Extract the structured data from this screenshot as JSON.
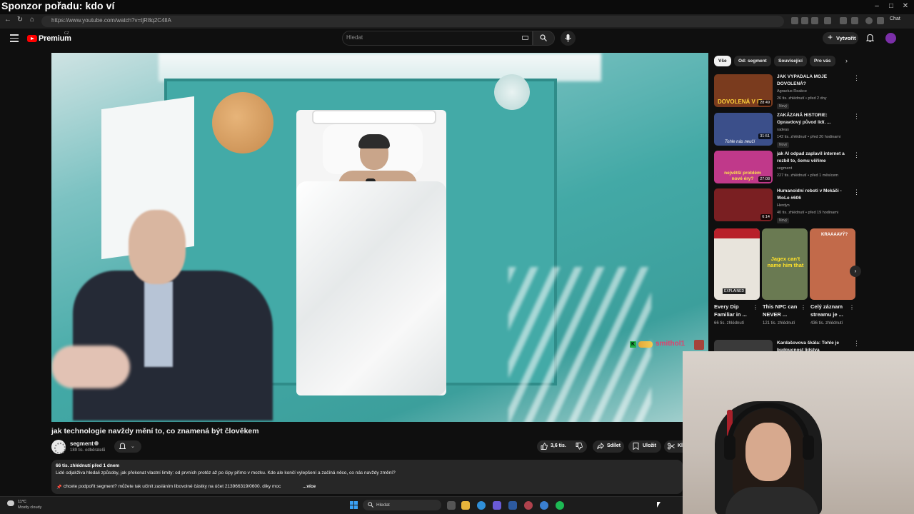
{
  "overlay": {
    "title": "Sponzor pořadu: kdo ví"
  },
  "browser": {
    "url": "https://www.youtube.com/watch?v=tjR8q2C4IlA",
    "copilot_label": "Chat",
    "window_controls": [
      "–",
      "□",
      "✕"
    ]
  },
  "header": {
    "brand": "Premium",
    "country": "CZ",
    "search_placeholder": "Hledat",
    "create_label": "Vytvořit",
    "accent": "#ff0000"
  },
  "player": {
    "chat_username": "smithol1",
    "chat_badge": "K"
  },
  "video": {
    "title": "jak technologie navždy mění to, co znamená být člověkem",
    "channel_name": "segment",
    "subscribers": "189 tis. odběratelů",
    "likes": "3,6 tis.",
    "share_label": "Sdílet",
    "save_label": "Uložit",
    "clip_label": "Kl",
    "description": {
      "meta": "66 tis. zhlédnutí  před 1 dnem",
      "line1": "Lidé odjakživa hledali způsoby, jak překonat vlastní limity: od prvních protéz až po čipy přímo v mozku. Kde ale končí vylepšení a začíná něco, co nás navždy změní?",
      "line2": "chcete podpořit segment? můžete tak učinit zasláním libovolné částky na účet 213966319/0600. díky moc",
      "more": "...více"
    }
  },
  "sidebar": {
    "chips": [
      "Vše",
      "Od: segment",
      "Související",
      "Pro vás"
    ],
    "recommendations": [
      {
        "title": "JAK VYPADALA MOJE DOVOLENÁ?",
        "channel": "Agraelus Reakce",
        "stats": "26 tis. zhlédnutí • před 2 dny",
        "badge": "Nový",
        "duration": "28:49",
        "thumb_text": "DOVOLENÁ V IT",
        "thumb_color": "#7a3b1e"
      },
      {
        "title": "ZAKÁZANÁ HISTORIE: Opravdový původ lidí. ...",
        "channel": "radeas",
        "stats": "142 tis. zhlédnutí • před 20 hodinami",
        "badge": "Nový",
        "duration": "31:51",
        "thumb_text": "Tohle nás neučí",
        "thumb_color": "#3b4f8a"
      },
      {
        "title": "jak AI odpad zaplavil internet a rozbil to, čemu věříme",
        "channel": "segment",
        "stats": "227 tis. zhlédnutí • před 1 měsícem",
        "badge": "",
        "duration": "27:08",
        "thumb_text": "největší problém nové éry?",
        "thumb_color": "#c0398a"
      },
      {
        "title": "Humanoidní roboti v Mekáči - WoLe #606",
        "channel": "Herdyn",
        "stats": "40 tis. zhlédnutí • před 19 hodinami",
        "badge": "Nový",
        "duration": "6:14",
        "thumb_text": "",
        "thumb_color": "#7a1f22"
      },
      {
        "title": "Kardašovova škála: Tohle je budoucnost lidstva",
        "channel": "",
        "stats": "",
        "badge": "",
        "duration": "",
        "thumb_text": "",
        "thumb_color": "#3a3a3a"
      }
    ],
    "shorts": [
      {
        "title": "Every Dip Familiar in ...",
        "views": "66 tis. zhlédnutí",
        "thumb_text": "EXPLAINED",
        "thumb_color": "#e8e4dc"
      },
      {
        "title": "This NPC can NEVER ...",
        "views": "121 tis. zhlédnutí",
        "thumb_text": "Jagex can't name him that",
        "thumb_color": "#6a7a52"
      },
      {
        "title": "Celý záznam streamu je ...",
        "views": "436 tis. zhlédnutí",
        "thumb_text": "KRAAAAVÝ?",
        "thumb_color": "#c26a4a"
      }
    ]
  },
  "taskbar": {
    "weather_temp": "11°C",
    "weather_text": "Mostly cloudy",
    "search_placeholder": "Hledat"
  }
}
